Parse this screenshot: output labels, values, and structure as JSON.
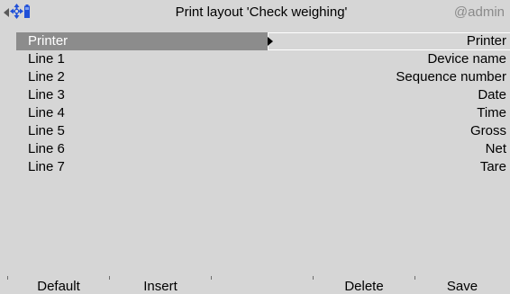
{
  "header": {
    "title": "Print layout 'Check weighing'",
    "user": "@admin",
    "icons": [
      "left-arrow-icon",
      "crosshair-move-icon",
      "battery-icon"
    ]
  },
  "rows": [
    {
      "key": "Printer",
      "value": "Printer",
      "selected": true
    },
    {
      "key": "Line 1",
      "value": "Device name"
    },
    {
      "key": "Line 2",
      "value": "Sequence number"
    },
    {
      "key": "Line 3",
      "value": "Date"
    },
    {
      "key": "Line 4",
      "value": "Time"
    },
    {
      "key": "Line 5",
      "value": "Gross"
    },
    {
      "key": "Line 6",
      "value": "Net"
    },
    {
      "key": "Line 7",
      "value": "Tare"
    }
  ],
  "softkeys": {
    "f1": "Default",
    "f2": "Insert",
    "f3": "",
    "f4": "Delete",
    "f5": "Save"
  },
  "colors": {
    "background": "#d6d6d6",
    "selection": "#8c8c8c",
    "icon_blue": "#2050d8",
    "muted_text": "#8a8a8a"
  }
}
